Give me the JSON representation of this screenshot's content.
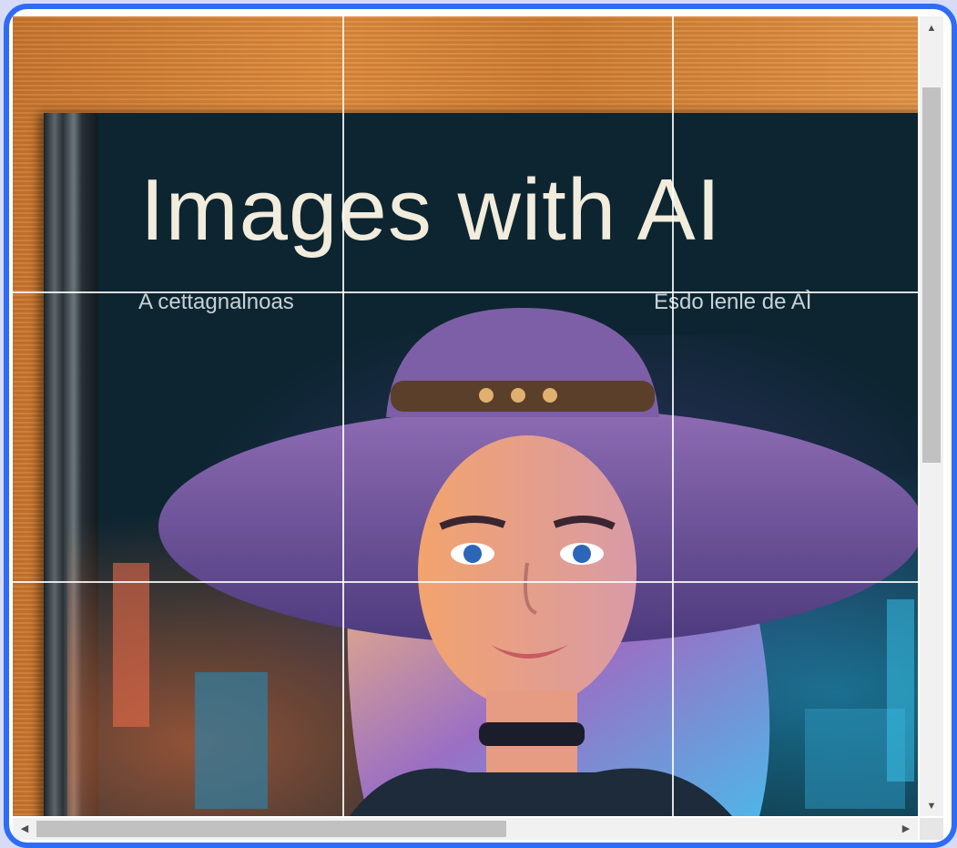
{
  "cover": {
    "title": "Images with AI",
    "subtitle_left": "A cettagnalnoas",
    "subtitle_right": "Esdo lenle de AÌ"
  },
  "image_icon": "portrait-illustration",
  "scrollbars": {
    "vertical": {
      "up_glyph": "▲",
      "down_glyph": "▼",
      "position": 0.0
    },
    "horizontal": {
      "left_glyph": "◀",
      "right_glyph": "▶",
      "position": 0.0
    }
  },
  "colors": {
    "frame_border": "#2f6cf5",
    "background": "#d7dbf7",
    "grid_lines": "#ffffff"
  },
  "grid": {
    "rows": 3,
    "columns": 3
  }
}
